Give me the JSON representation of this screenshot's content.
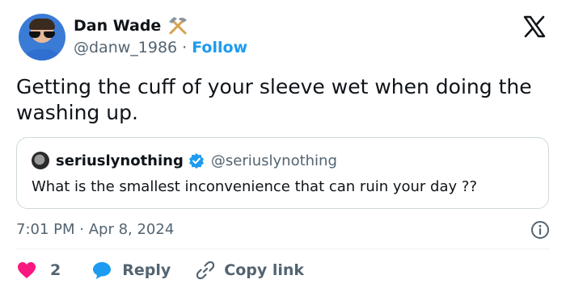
{
  "author": {
    "display_name": "Dan Wade",
    "name_emoji_icon": "hammer-and-pick-icon",
    "handle": "@danw_1986",
    "separator": "·",
    "follow_label": "Follow"
  },
  "tweet": {
    "text": "Getting the cuff of your sleeve wet when doing the washing up.",
    "time": "7:01 PM",
    "separator": " · ",
    "date": "Apr 8, 2024"
  },
  "quoted_tweet": {
    "display_name": "seriuslynothing",
    "handle": "@seriuslynothing",
    "text": "What is the smallest inconvenience that can ruin your day ??"
  },
  "actions": {
    "like_count": "2",
    "reply_label": "Reply",
    "copy_link_label": "Copy link"
  },
  "colors": {
    "accent": "#1d9bf0",
    "like": "#f91880",
    "text": "#0f1419",
    "secondary_text": "#536471",
    "border": "#cfd9de"
  },
  "icons": [
    "x-logo-icon",
    "hammer-and-pick-icon",
    "verified-badge-icon",
    "info-icon",
    "heart-icon",
    "reply-bubble-icon",
    "link-icon"
  ]
}
